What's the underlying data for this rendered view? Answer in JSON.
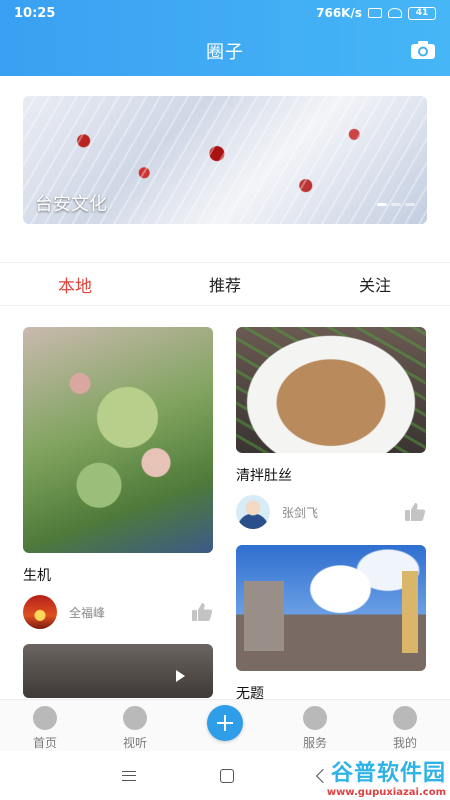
{
  "status_bar": {
    "time": "10:25",
    "network_speed": "766K/s",
    "battery": "41"
  },
  "header": {
    "title": "圈子",
    "camera_icon": "camera-icon"
  },
  "banner": {
    "caption": "台安文化",
    "slide_count": 3,
    "active_slide": 1
  },
  "tabs": [
    {
      "label": "本地",
      "active": true
    },
    {
      "label": "推荐",
      "active": false
    },
    {
      "label": "关注",
      "active": false
    }
  ],
  "feed": {
    "left": [
      {
        "title": "生机",
        "author": "全福峰"
      },
      {
        "title": "",
        "author": "",
        "is_video": true
      }
    ],
    "right": [
      {
        "title": "清拌肚丝",
        "author": "张剑飞"
      },
      {
        "title": "无题",
        "author": ""
      }
    ]
  },
  "bottom_nav": [
    {
      "label": "首页",
      "icon": "home-icon"
    },
    {
      "label": "视听",
      "icon": "play-icon"
    },
    {
      "label": "",
      "icon": "plus-icon"
    },
    {
      "label": "服务",
      "icon": "handshake-icon"
    },
    {
      "label": "我的",
      "icon": "user-icon"
    }
  ],
  "watermark": {
    "name": "谷普软件园",
    "url": "www.gupuxiazai.com"
  },
  "colors": {
    "header_bg": "#3aa0f2",
    "active_tab": "#e0453c",
    "plus_button": "#2f9ee8"
  }
}
